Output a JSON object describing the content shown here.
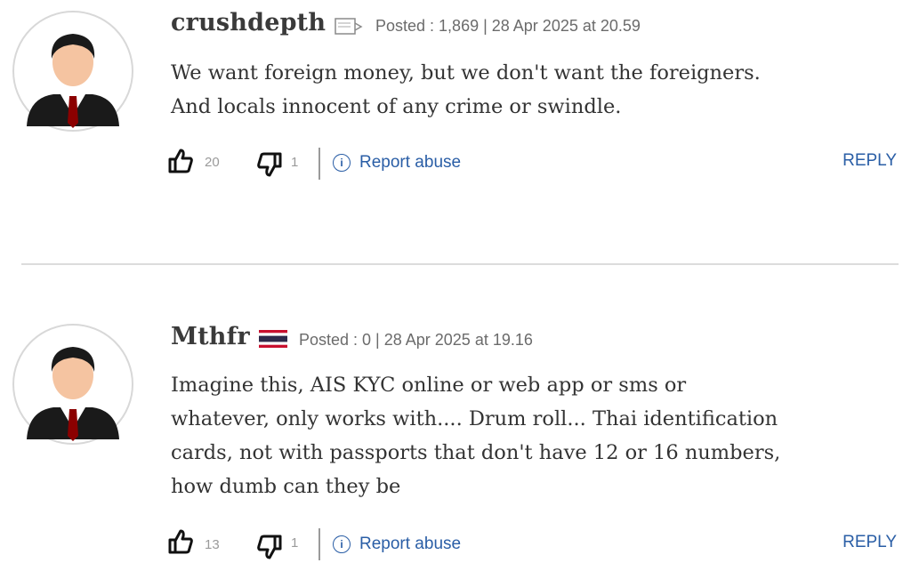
{
  "comments": [
    {
      "username": "crushdepth",
      "user_icon": "flag-placeholder-icon",
      "posted": "Posted : 1,869 | 28 Apr 2025 at 20.59",
      "body_lines": [
        "We want foreign money, but we don't want the foreigners.",
        "And locals innocent of any crime or swindle."
      ],
      "likes": "20",
      "dislikes": "1",
      "report_label": "Report abuse",
      "reply_label": "REPLY"
    },
    {
      "username": "Mthfr",
      "user_icon": "thailand-flag-icon",
      "posted": "Posted : 0 | 28 Apr 2025 at 19.16",
      "body_lines": [
        "Imagine this, AIS KYC online or web app or sms or",
        "whatever, only works with.... Drum roll... Thai identification",
        "cards, not with passports that don't have 12 or 16 numbers,",
        "how dumb can they be"
      ],
      "likes": "13",
      "dislikes": "1",
      "report_label": "Report abuse",
      "reply_label": "REPLY"
    }
  ],
  "colors": {
    "link": "#2a5ea6",
    "tie": "#8b0000",
    "face": "#f5c4a1",
    "text": "#333333"
  }
}
